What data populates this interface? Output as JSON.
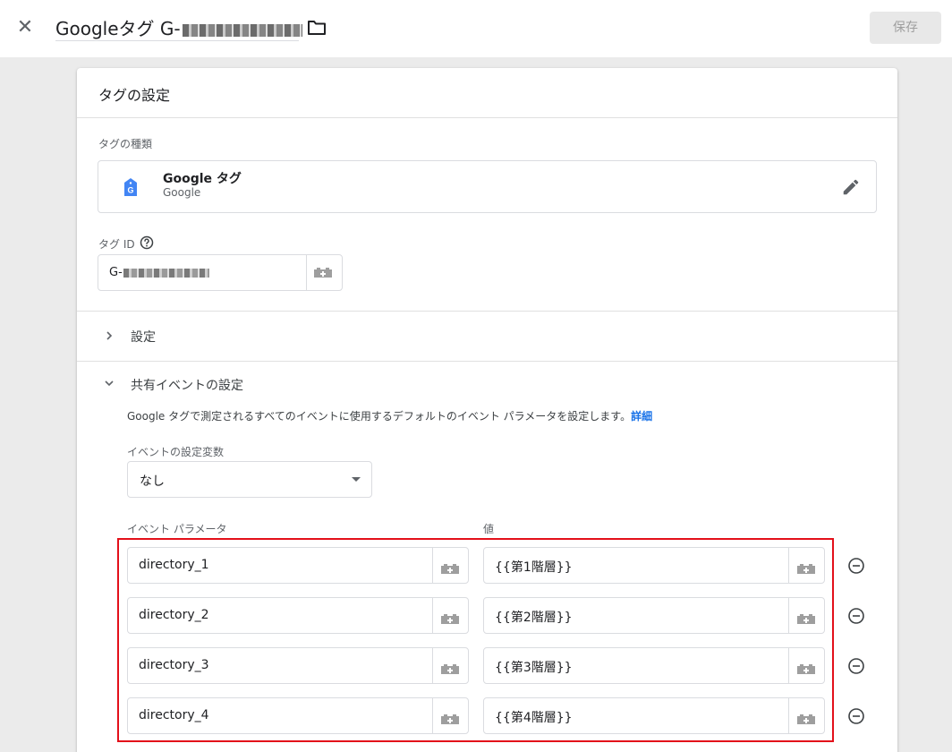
{
  "header": {
    "title_prefix": "Googleタグ G-",
    "save_label": "保存"
  },
  "card": {
    "title": "タグの設定",
    "tag_type": {
      "label": "タグの種類",
      "name": "Google タグ",
      "vendor": "Google"
    },
    "tag_id": {
      "label": "タグ ID",
      "value_prefix": "G-"
    },
    "sections": {
      "settings_label": "設定",
      "shared_events_label": "共有イベントの設定",
      "description": "Google タグで測定されるすべてのイベントに使用するデフォルトのイベント パラメータを設定します。",
      "details_link": "詳細"
    },
    "event_settings_variable": {
      "label": "イベントの設定変数",
      "selected": "なし"
    },
    "params": {
      "param_header": "イベント パラメータ",
      "value_header": "値",
      "rows": [
        {
          "name": "directory_1",
          "value": "{{第1階層}}"
        },
        {
          "name": "directory_2",
          "value": "{{第2階層}}"
        },
        {
          "name": "directory_3",
          "value": "{{第3階層}}"
        },
        {
          "name": "directory_4",
          "value": "{{第4階層}}"
        }
      ]
    }
  },
  "colors": {
    "accent": "#1a73e8",
    "highlight": "#e3101a",
    "tag_logo": "#4285f4"
  },
  "icons": [
    "close-icon",
    "folder-icon",
    "tag-logo-icon",
    "edit-pencil-icon",
    "help-icon",
    "variable-brick-icon",
    "chevron-right-icon",
    "chevron-down-icon",
    "dropdown-arrow-icon",
    "remove-circle-icon"
  ]
}
